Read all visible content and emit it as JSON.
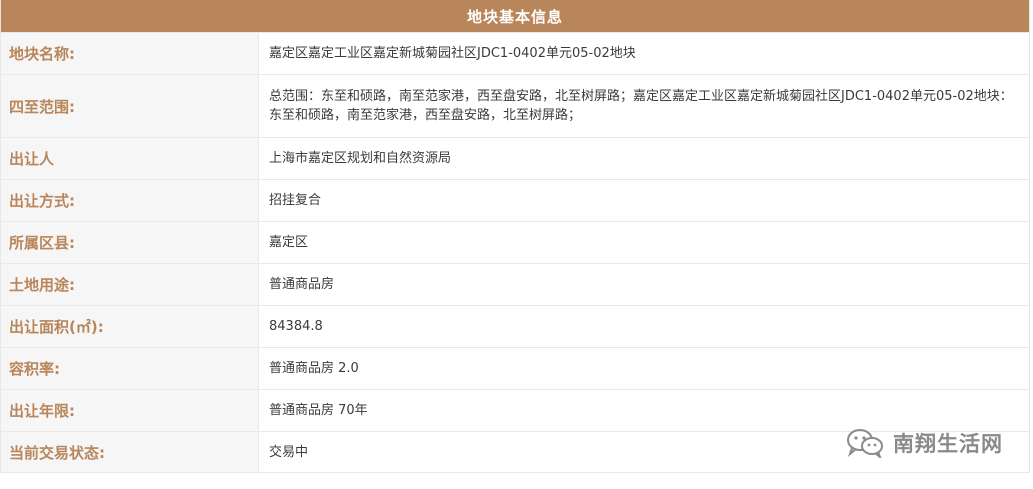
{
  "table": {
    "title": "地块基本信息",
    "rows": [
      {
        "label": "地块名称:",
        "value": "嘉定区嘉定工业区嘉定新城菊园社区JDC1-0402单元05-02地块"
      },
      {
        "label": "四至范围:",
        "value": "总范围：东至和硕路，南至范家港，西至盘安路，北至树屏路；嘉定区嘉定工业区嘉定新城菊园社区JDC1-0402单元05-02地块：东至和硕路，南至范家港，西至盘安路，北至树屏路；"
      },
      {
        "label": "出让人",
        "value": "上海市嘉定区规划和自然资源局"
      },
      {
        "label": "出让方式:",
        "value": "招挂复合"
      },
      {
        "label": "所属区县:",
        "value": "嘉定区"
      },
      {
        "label": "土地用途:",
        "value": "普通商品房"
      },
      {
        "label": "出让面积(㎡):",
        "value": "84384.8"
      },
      {
        "label": "容积率:",
        "value": "普通商品房 2.0"
      },
      {
        "label": "出让年限:",
        "value": "普通商品房 70年"
      },
      {
        "label": "当前交易状态:",
        "value": "交易中"
      }
    ]
  },
  "watermark": {
    "text": "南翔生活网",
    "icon": "wechat-icon"
  }
}
